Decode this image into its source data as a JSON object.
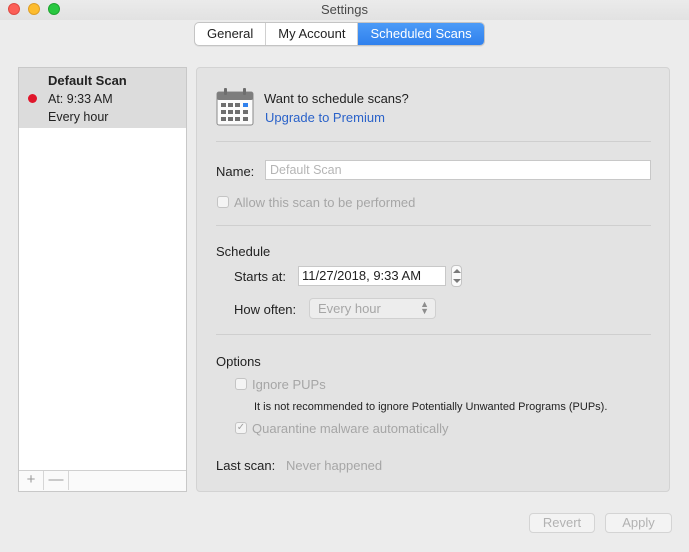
{
  "window": {
    "title": "Settings"
  },
  "tabs": [
    {
      "label": "General",
      "active": false
    },
    {
      "label": "My Account",
      "active": false
    },
    {
      "label": "Scheduled Scans",
      "active": true
    }
  ],
  "sidebar": {
    "items": [
      {
        "name": "Default Scan",
        "time": "At: 9:33 AM",
        "frequency": "Every hour",
        "status_color": "#e0162b"
      }
    ],
    "add_label": "+",
    "remove_label": "—"
  },
  "promo": {
    "question": "Want to schedule scans?",
    "link": "Upgrade to Premium",
    "icon": "calendar-icon"
  },
  "form": {
    "name_label": "Name:",
    "name_placeholder": "Default Scan",
    "allow_label": "Allow this scan to be performed",
    "schedule_title": "Schedule",
    "starts_label": "Starts at:",
    "starts_value": "11/27/2018,   9:33 AM",
    "how_often_label": "How often:",
    "how_often_value": "Every hour",
    "options_title": "Options",
    "ignore_pups_label": "Ignore PUPs",
    "pups_note": "It is not recommended to ignore Potentially Unwanted Programs (PUPs).",
    "quarantine_label": "Quarantine malware automatically",
    "quarantine_checked": true,
    "last_scan_label": "Last scan:",
    "last_scan_value": "Never happened"
  },
  "buttons": {
    "revert": "Revert",
    "apply": "Apply"
  },
  "colors": {
    "accent": "#2f80ed",
    "link": "#2a62c9",
    "status_red": "#e0162b"
  }
}
